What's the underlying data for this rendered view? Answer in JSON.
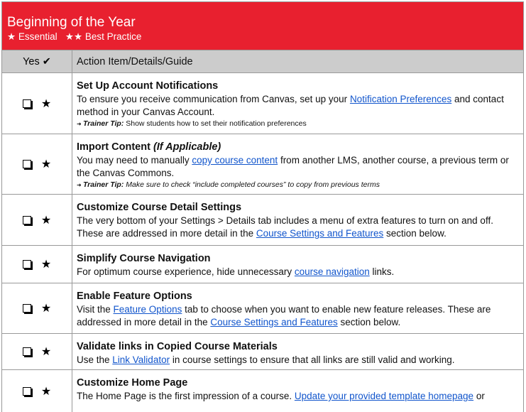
{
  "header": {
    "title": "Beginning of the Year",
    "legend": "★ Essential   ★★ Best Practice"
  },
  "columns": {
    "yes": "Yes ✔",
    "action": "Action Item/Details/Guide"
  },
  "rows": [
    {
      "h": 86,
      "marker": "★",
      "title": "Set Up Account Notifications",
      "title_italic": "",
      "desc": [
        {
          "t": "To ensure you receive communication from Canvas, set up your "
        },
        {
          "t": "Notification Preferences",
          "link": true
        },
        {
          "t": " and contact method in your Canvas Account."
        }
      ],
      "tip_label": "Trainer Tip:",
      "tip": " Show students how to set their notification preferences",
      "tip_italic": false
    },
    {
      "h": 85,
      "marker": "★",
      "title": "Import Content ",
      "title_italic": "(If Applicable)",
      "desc": [
        {
          "t": "You may need to manually "
        },
        {
          "t": "copy course content",
          "link": true
        },
        {
          "t": " from another LMS, another course, a previous term or the Canvas Commons."
        }
      ],
      "tip_label": "Trainer Tip:",
      "tip": " Make sure to check “include completed courses” to copy from previous terms",
      "tip_italic": true
    },
    {
      "h": 72,
      "marker": "★",
      "title": "Customize Course Detail Settings",
      "title_italic": "",
      "desc": [
        {
          "t": "The very bottom of your Settings > Details tab includes a menu of extra features to turn on and off.  These are addressed in more detail in the "
        },
        {
          "t": "Course Settings and Features",
          "link": true
        },
        {
          "t": " section below."
        }
      ]
    },
    {
      "h": 53,
      "marker": "★",
      "title": "Simplify Course Navigation",
      "title_italic": "",
      "desc": [
        {
          "t": "For optimum course experience, hide unnecessary "
        },
        {
          "t": "course navigation",
          "link": true
        },
        {
          "t": " links."
        }
      ]
    },
    {
      "h": 71,
      "marker": "★",
      "title": "Enable Feature Options",
      "title_italic": "",
      "desc": [
        {
          "t": "Visit the "
        },
        {
          "t": "Feature Options",
          "link": true
        },
        {
          "t": " tab to choose when you want to enable new feature releases. These are addressed in more detail in the "
        },
        {
          "t": "Course Settings and Features",
          "link": true
        },
        {
          "t": " section below."
        }
      ]
    },
    {
      "h": 51,
      "marker": "★",
      "title": "Validate links in Copied Course Materials",
      "title_italic": "",
      "desc": [
        {
          "t": "Use the "
        },
        {
          "t": "Link Validator",
          "link": true
        },
        {
          "t": " in course settings to ensure that all links are still valid and working."
        }
      ]
    },
    {
      "h": 60,
      "marker": "★",
      "title": "Customize Home Page",
      "title_italic": "",
      "desc": [
        {
          "t": "The Home Page is the first impression of a course. "
        },
        {
          "t": "Update your provided template homepage",
          "link": true
        },
        {
          "t": " or"
        }
      ]
    }
  ]
}
